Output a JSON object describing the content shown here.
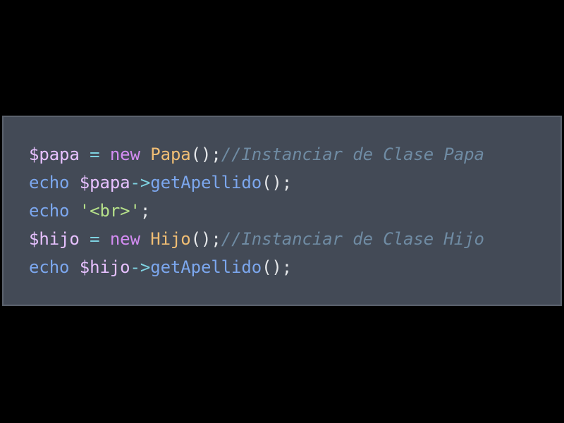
{
  "colors": {
    "page_background": "#000000",
    "panel_background": "#434a56",
    "panel_border": "#5b626d",
    "variable": "#e7c1ff",
    "operator": "#7fd3e2",
    "keyword_new": "#d38cf2",
    "class_name": "#f1be74",
    "punctuation": "#e6e8ea",
    "comment": "#6f8ba3",
    "keyword_echo": "#7ca7ee",
    "method": "#7ca7ee",
    "string": "#b6e18a"
  },
  "code": {
    "language": "php",
    "lines": [
      {
        "tokens": [
          {
            "type": "variable",
            "text": "$papa"
          },
          {
            "type": "default",
            "text": " "
          },
          {
            "type": "operator",
            "text": "="
          },
          {
            "type": "default",
            "text": " "
          },
          {
            "type": "keyword-new",
            "text": "new"
          },
          {
            "type": "default",
            "text": " "
          },
          {
            "type": "class",
            "text": "Papa"
          },
          {
            "type": "punct",
            "text": "();"
          },
          {
            "type": "comment",
            "text": "//Instanciar de Clase Papa"
          }
        ]
      },
      {
        "tokens": [
          {
            "type": "keyword-echo",
            "text": "echo"
          },
          {
            "type": "default",
            "text": " "
          },
          {
            "type": "variable",
            "text": "$papa"
          },
          {
            "type": "operator",
            "text": "->"
          },
          {
            "type": "method",
            "text": "getApellido"
          },
          {
            "type": "punct",
            "text": "();"
          }
        ]
      },
      {
        "tokens": [
          {
            "type": "keyword-echo",
            "text": "echo"
          },
          {
            "type": "default",
            "text": " "
          },
          {
            "type": "string",
            "text": "'<br>'"
          },
          {
            "type": "punct",
            "text": ";"
          }
        ]
      },
      {
        "tokens": [
          {
            "type": "variable",
            "text": "$hijo"
          },
          {
            "type": "default",
            "text": " "
          },
          {
            "type": "operator",
            "text": "="
          },
          {
            "type": "default",
            "text": " "
          },
          {
            "type": "keyword-new",
            "text": "new"
          },
          {
            "type": "default",
            "text": " "
          },
          {
            "type": "class",
            "text": "Hijo"
          },
          {
            "type": "punct",
            "text": "();"
          },
          {
            "type": "comment",
            "text": "//Instanciar de Clase Hijo"
          }
        ]
      },
      {
        "tokens": [
          {
            "type": "keyword-echo",
            "text": "echo"
          },
          {
            "type": "default",
            "text": " "
          },
          {
            "type": "variable",
            "text": "$hijo"
          },
          {
            "type": "operator",
            "text": "->"
          },
          {
            "type": "method",
            "text": "getApellido"
          },
          {
            "type": "punct",
            "text": "();"
          }
        ]
      }
    ]
  }
}
